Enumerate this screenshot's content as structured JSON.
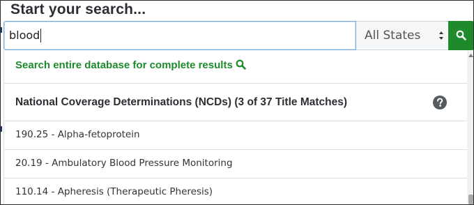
{
  "heading": "Start your search...",
  "search": {
    "value": "blood",
    "state_selected": "All States"
  },
  "dropdown": {
    "all_results_link": "Search entire database for complete results",
    "section_title": "National Coverage Determinations (NCDs) (3 of 37 Title Matches)",
    "results": [
      "190.25 - Alpha-fetoprotein",
      "20.19 - Ambulatory Blood Pressure Monitoring",
      "110.14 - Apheresis (Therapeutic Pheresis)"
    ]
  },
  "colors": {
    "accent_green": "#1e8a2c",
    "heading_text": "#2b2f33",
    "focus_border": "#7aaed8"
  },
  "icons": {
    "search_button": "search-icon",
    "link_icon": "search-icon",
    "help": "question-circle-icon",
    "select": "sort-arrows-icon"
  }
}
